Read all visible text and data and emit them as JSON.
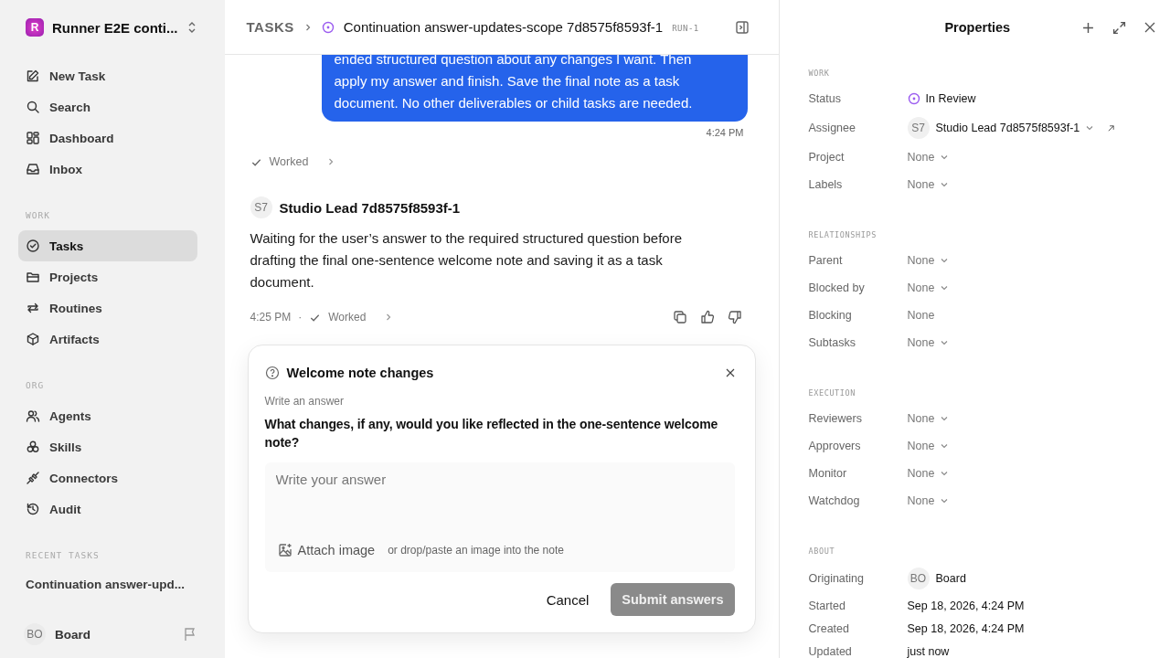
{
  "sidebar": {
    "workspace": {
      "initial": "R",
      "name": "Runner E2E conti..."
    },
    "top_items": [
      {
        "label": "New Task",
        "selected": false
      },
      {
        "label": "Search",
        "selected": false
      },
      {
        "label": "Dashboard",
        "selected": false
      },
      {
        "label": "Inbox",
        "selected": false
      }
    ],
    "sections": [
      {
        "title": "WORK",
        "items": [
          {
            "label": "Tasks",
            "selected": true
          },
          {
            "label": "Projects",
            "selected": false
          },
          {
            "label": "Routines",
            "selected": false
          },
          {
            "label": "Artifacts",
            "selected": false
          }
        ]
      },
      {
        "title": "ORG",
        "items": [
          {
            "label": "Agents",
            "selected": false
          },
          {
            "label": "Skills",
            "selected": false
          },
          {
            "label": "Connectors",
            "selected": false
          },
          {
            "label": "Audit",
            "selected": false
          }
        ]
      }
    ],
    "recent": {
      "title": "RECENT TASKS",
      "items": [
        "Continuation answer-upd..."
      ]
    },
    "user": {
      "initials": "BO",
      "name": "Board"
    }
  },
  "header": {
    "breadcrumb": "TASKS",
    "title": "Continuation answer-updates-scope 7d8575f8593f-1",
    "run": "RUN-1"
  },
  "thread": {
    "user_message": {
      "text": "ended structured question about any changes I want. Then apply my answer and finish. Save the final note as a task document. No other deliverables or child tasks are needed.",
      "time": "4:24 PM",
      "worked": "Worked"
    },
    "agent_message": {
      "initials": "S7",
      "name": "Studio Lead 7d8575f8593f-1",
      "text": "Waiting for the user’s answer to the required structured question before drafting the final one-sentence welcome note and saving it as a task document.",
      "time": "4:25 PM",
      "separator": "·",
      "worked": "Worked"
    }
  },
  "question": {
    "title": "Welcome note changes",
    "hint": "Write an answer",
    "question": "What changes, if any, would you like reflected in the one-sentence welcome note?",
    "placeholder": "Write your answer",
    "attach": "Attach image",
    "attach_hint": "or drop/paste an image into the note",
    "cancel": "Cancel",
    "submit": {
      "label": "Submit answers",
      "disabled": true
    }
  },
  "properties": {
    "title": "Properties",
    "sections": [
      {
        "title": "WORK",
        "rows": [
          {
            "label": "Status",
            "value": "In Review",
            "kind": "status"
          },
          {
            "label": "Assignee",
            "initials": "S7",
            "value": "Studio Lead 7d8575f8593f-1",
            "kind": "person",
            "dropdown": true
          },
          {
            "label": "Project",
            "value": "None",
            "kind": "select"
          },
          {
            "label": "Labels",
            "value": "None",
            "kind": "select"
          }
        ]
      },
      {
        "title": "RELATIONSHIPS",
        "rows": [
          {
            "label": "Parent",
            "value": "None",
            "kind": "select"
          },
          {
            "label": "Blocked by",
            "value": "None",
            "kind": "select"
          },
          {
            "label": "Blocking",
            "value": "None",
            "kind": "text"
          },
          {
            "label": "Subtasks",
            "value": "None",
            "kind": "select"
          }
        ]
      },
      {
        "title": "EXECUTION",
        "rows": [
          {
            "label": "Reviewers",
            "value": "None",
            "kind": "select"
          },
          {
            "label": "Approvers",
            "value": "None",
            "kind": "select"
          },
          {
            "label": "Monitor",
            "value": "None",
            "kind": "select"
          },
          {
            "label": "Watchdog",
            "value": "None",
            "kind": "select"
          }
        ]
      },
      {
        "title": "ABOUT",
        "rows": [
          {
            "label": "Originating",
            "initials": "BO",
            "value": "Board",
            "kind": "person",
            "dropdown": false
          },
          {
            "label": "Started",
            "value": "Sep 18, 2026, 4:24 PM",
            "kind": "date"
          },
          {
            "label": "Created",
            "value": "Sep 18, 2026, 4:24 PM",
            "kind": "date"
          },
          {
            "label": "Updated",
            "value": "just now",
            "kind": "date"
          }
        ]
      }
    ]
  }
}
